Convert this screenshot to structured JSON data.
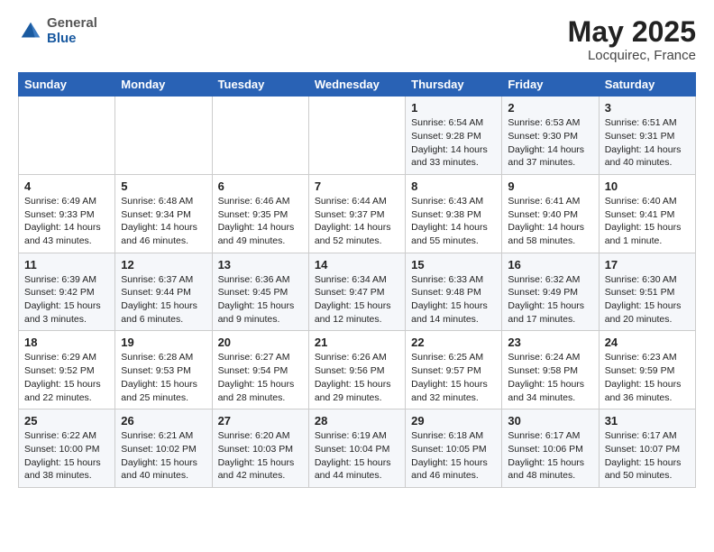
{
  "header": {
    "logo_general": "General",
    "logo_blue": "Blue",
    "title": "May 2025",
    "location": "Locquirec, France"
  },
  "weekdays": [
    "Sunday",
    "Monday",
    "Tuesday",
    "Wednesday",
    "Thursday",
    "Friday",
    "Saturday"
  ],
  "weeks": [
    [
      {
        "day": "",
        "info": ""
      },
      {
        "day": "",
        "info": ""
      },
      {
        "day": "",
        "info": ""
      },
      {
        "day": "",
        "info": ""
      },
      {
        "day": "1",
        "info": "Sunrise: 6:54 AM\nSunset: 9:28 PM\nDaylight: 14 hours\nand 33 minutes."
      },
      {
        "day": "2",
        "info": "Sunrise: 6:53 AM\nSunset: 9:30 PM\nDaylight: 14 hours\nand 37 minutes."
      },
      {
        "day": "3",
        "info": "Sunrise: 6:51 AM\nSunset: 9:31 PM\nDaylight: 14 hours\nand 40 minutes."
      }
    ],
    [
      {
        "day": "4",
        "info": "Sunrise: 6:49 AM\nSunset: 9:33 PM\nDaylight: 14 hours\nand 43 minutes."
      },
      {
        "day": "5",
        "info": "Sunrise: 6:48 AM\nSunset: 9:34 PM\nDaylight: 14 hours\nand 46 minutes."
      },
      {
        "day": "6",
        "info": "Sunrise: 6:46 AM\nSunset: 9:35 PM\nDaylight: 14 hours\nand 49 minutes."
      },
      {
        "day": "7",
        "info": "Sunrise: 6:44 AM\nSunset: 9:37 PM\nDaylight: 14 hours\nand 52 minutes."
      },
      {
        "day": "8",
        "info": "Sunrise: 6:43 AM\nSunset: 9:38 PM\nDaylight: 14 hours\nand 55 minutes."
      },
      {
        "day": "9",
        "info": "Sunrise: 6:41 AM\nSunset: 9:40 PM\nDaylight: 14 hours\nand 58 minutes."
      },
      {
        "day": "10",
        "info": "Sunrise: 6:40 AM\nSunset: 9:41 PM\nDaylight: 15 hours\nand 1 minute."
      }
    ],
    [
      {
        "day": "11",
        "info": "Sunrise: 6:39 AM\nSunset: 9:42 PM\nDaylight: 15 hours\nand 3 minutes."
      },
      {
        "day": "12",
        "info": "Sunrise: 6:37 AM\nSunset: 9:44 PM\nDaylight: 15 hours\nand 6 minutes."
      },
      {
        "day": "13",
        "info": "Sunrise: 6:36 AM\nSunset: 9:45 PM\nDaylight: 15 hours\nand 9 minutes."
      },
      {
        "day": "14",
        "info": "Sunrise: 6:34 AM\nSunset: 9:47 PM\nDaylight: 15 hours\nand 12 minutes."
      },
      {
        "day": "15",
        "info": "Sunrise: 6:33 AM\nSunset: 9:48 PM\nDaylight: 15 hours\nand 14 minutes."
      },
      {
        "day": "16",
        "info": "Sunrise: 6:32 AM\nSunset: 9:49 PM\nDaylight: 15 hours\nand 17 minutes."
      },
      {
        "day": "17",
        "info": "Sunrise: 6:30 AM\nSunset: 9:51 PM\nDaylight: 15 hours\nand 20 minutes."
      }
    ],
    [
      {
        "day": "18",
        "info": "Sunrise: 6:29 AM\nSunset: 9:52 PM\nDaylight: 15 hours\nand 22 minutes."
      },
      {
        "day": "19",
        "info": "Sunrise: 6:28 AM\nSunset: 9:53 PM\nDaylight: 15 hours\nand 25 minutes."
      },
      {
        "day": "20",
        "info": "Sunrise: 6:27 AM\nSunset: 9:54 PM\nDaylight: 15 hours\nand 28 minutes."
      },
      {
        "day": "21",
        "info": "Sunrise: 6:26 AM\nSunset: 9:56 PM\nDaylight: 15 hours\nand 29 minutes."
      },
      {
        "day": "22",
        "info": "Sunrise: 6:25 AM\nSunset: 9:57 PM\nDaylight: 15 hours\nand 32 minutes."
      },
      {
        "day": "23",
        "info": "Sunrise: 6:24 AM\nSunset: 9:58 PM\nDaylight: 15 hours\nand 34 minutes."
      },
      {
        "day": "24",
        "info": "Sunrise: 6:23 AM\nSunset: 9:59 PM\nDaylight: 15 hours\nand 36 minutes."
      }
    ],
    [
      {
        "day": "25",
        "info": "Sunrise: 6:22 AM\nSunset: 10:00 PM\nDaylight: 15 hours\nand 38 minutes."
      },
      {
        "day": "26",
        "info": "Sunrise: 6:21 AM\nSunset: 10:02 PM\nDaylight: 15 hours\nand 40 minutes."
      },
      {
        "day": "27",
        "info": "Sunrise: 6:20 AM\nSunset: 10:03 PM\nDaylight: 15 hours\nand 42 minutes."
      },
      {
        "day": "28",
        "info": "Sunrise: 6:19 AM\nSunset: 10:04 PM\nDaylight: 15 hours\nand 44 minutes."
      },
      {
        "day": "29",
        "info": "Sunrise: 6:18 AM\nSunset: 10:05 PM\nDaylight: 15 hours\nand 46 minutes."
      },
      {
        "day": "30",
        "info": "Sunrise: 6:17 AM\nSunset: 10:06 PM\nDaylight: 15 hours\nand 48 minutes."
      },
      {
        "day": "31",
        "info": "Sunrise: 6:17 AM\nSunset: 10:07 PM\nDaylight: 15 hours\nand 50 minutes."
      }
    ]
  ]
}
